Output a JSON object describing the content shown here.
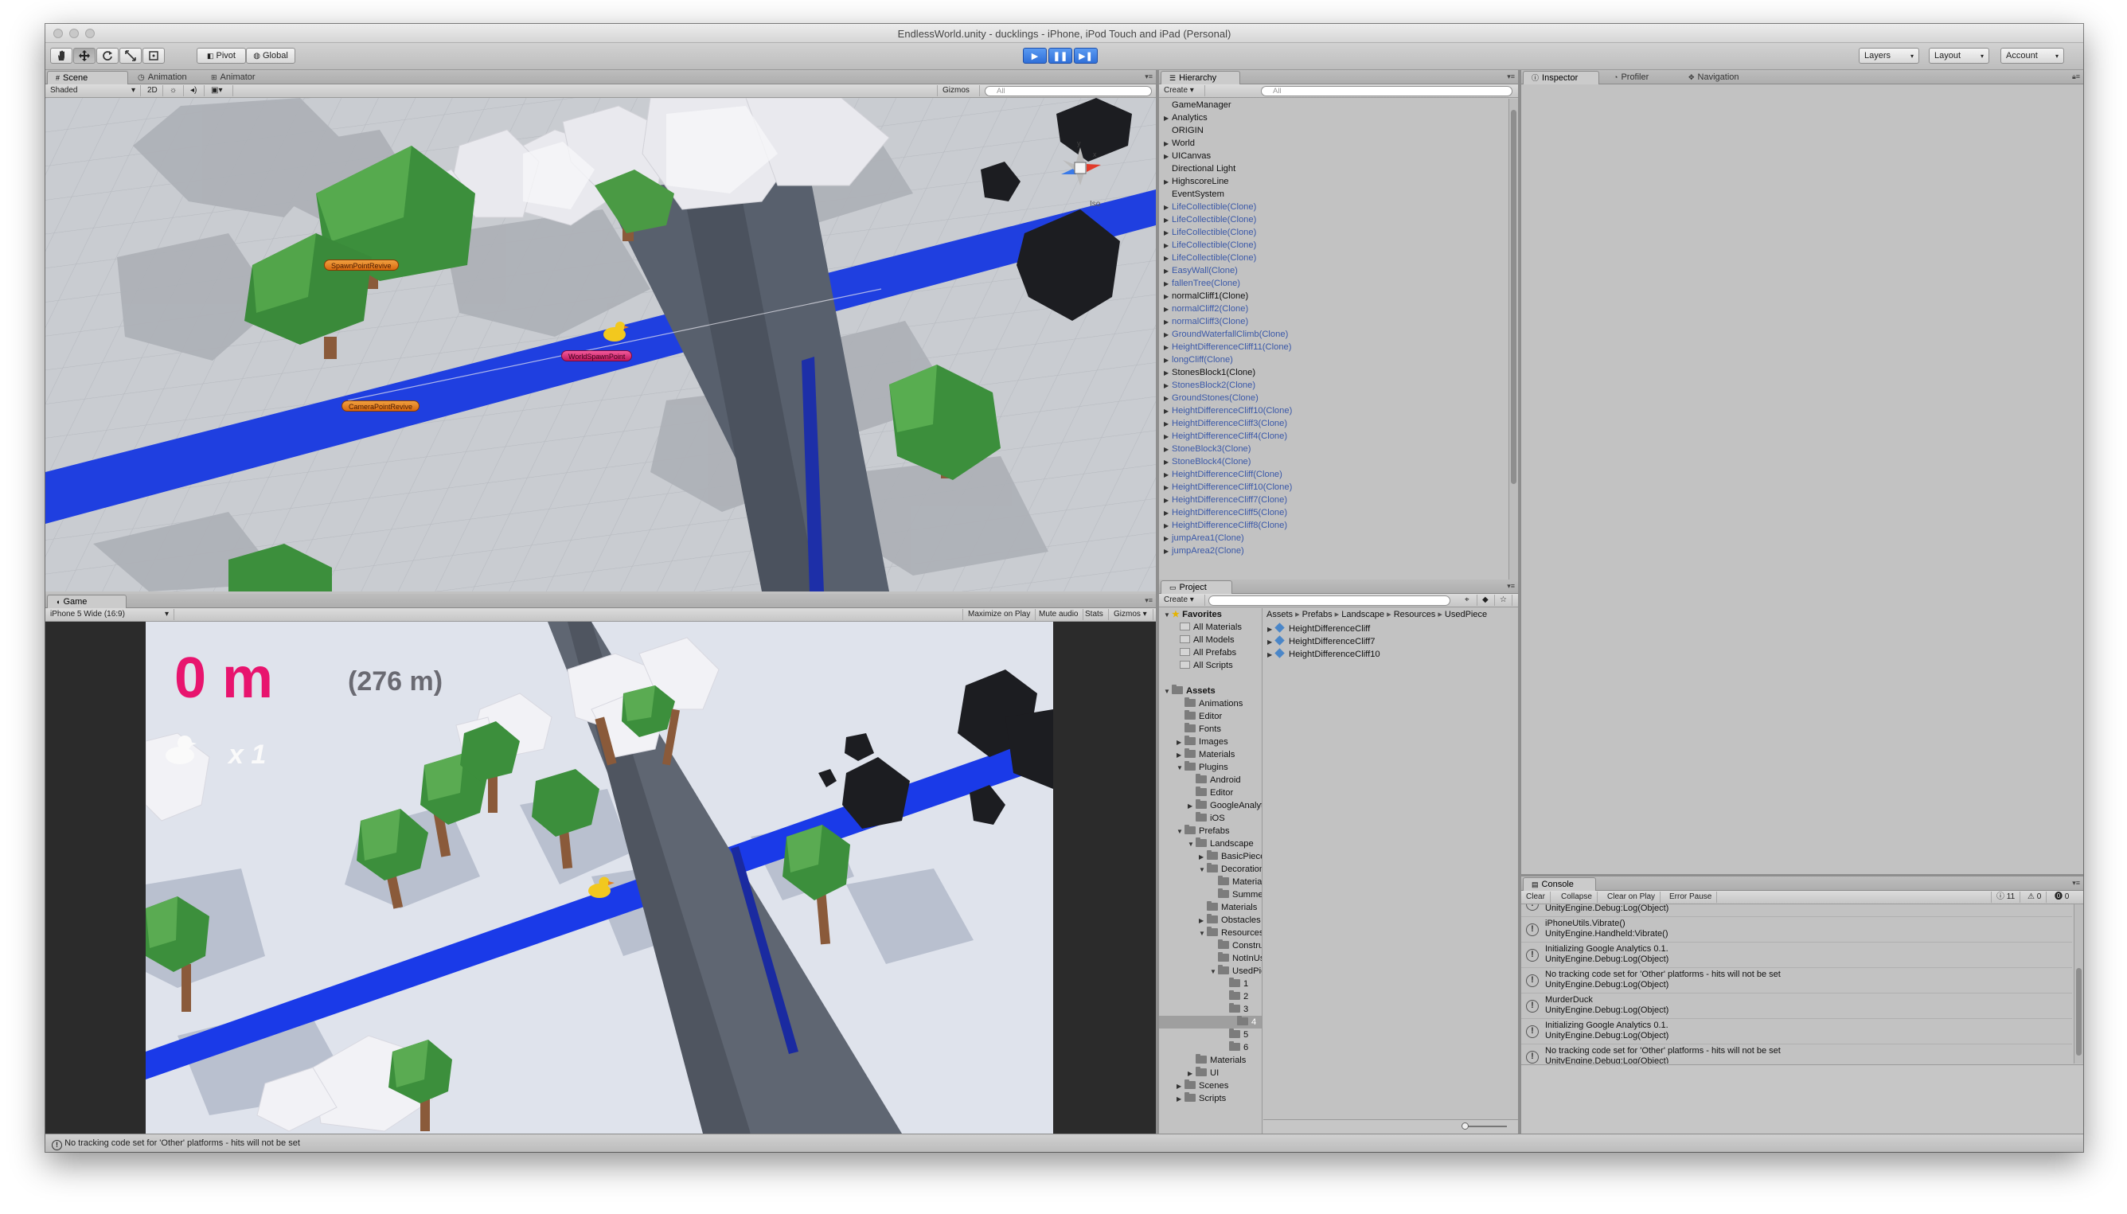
{
  "window": {
    "title": "EndlessWorld.unity - ducklings - iPhone, iPod Touch and iPad (Personal)"
  },
  "toolbar": {
    "pivot_label": "Pivot",
    "global_label": "Global",
    "layers_label": "Layers",
    "layout_label": "Layout",
    "account_label": "Account"
  },
  "scene_panel": {
    "tabs": [
      "Scene",
      "Animation",
      "Animator"
    ],
    "shading_mode": "Shaded",
    "mode_2d": "2D",
    "gizmos_label": "Gizmos",
    "search_placeholder": "All",
    "tags": [
      "SpawnPointRevive",
      "WorldSpawnPoint",
      "CameraPointRevive"
    ],
    "gizmo_persp_label": "Iso"
  },
  "game_panel": {
    "tab": "Game",
    "aspect": "iPhone 5 Wide (16:9)",
    "options": [
      "Maximize on Play",
      "Mute audio",
      "Stats",
      "Gizmos"
    ],
    "distance": "0 m",
    "best": "(276 m)",
    "lives": "x 1"
  },
  "hierarchy": {
    "tab": "Hierarchy",
    "create_label": "Create",
    "search_placeholder": "All",
    "items": [
      {
        "label": "GameManager",
        "arrow": false,
        "clone": false
      },
      {
        "label": "Analytics",
        "arrow": true,
        "clone": false
      },
      {
        "label": "ORIGIN",
        "arrow": false,
        "clone": false
      },
      {
        "label": "World",
        "arrow": true,
        "clone": false
      },
      {
        "label": "UICanvas",
        "arrow": true,
        "clone": false
      },
      {
        "label": "Directional Light",
        "arrow": false,
        "clone": false
      },
      {
        "label": "HighscoreLine",
        "arrow": true,
        "clone": false
      },
      {
        "label": "EventSystem",
        "arrow": false,
        "clone": false
      },
      {
        "label": "LifeCollectible(Clone)",
        "arrow": true,
        "clone": true
      },
      {
        "label": "LifeCollectible(Clone)",
        "arrow": true,
        "clone": true
      },
      {
        "label": "LifeCollectible(Clone)",
        "arrow": true,
        "clone": true
      },
      {
        "label": "LifeCollectible(Clone)",
        "arrow": true,
        "clone": true
      },
      {
        "label": "LifeCollectible(Clone)",
        "arrow": true,
        "clone": true
      },
      {
        "label": "EasyWall(Clone)",
        "arrow": true,
        "clone": true
      },
      {
        "label": "fallenTree(Clone)",
        "arrow": true,
        "clone": true
      },
      {
        "label": "normalCliff1(Clone)",
        "arrow": true,
        "clone": false
      },
      {
        "label": "normalCliff2(Clone)",
        "arrow": true,
        "clone": true
      },
      {
        "label": "normalCliff3(Clone)",
        "arrow": true,
        "clone": true
      },
      {
        "label": "GroundWaterfallClimb(Clone)",
        "arrow": true,
        "clone": true
      },
      {
        "label": "HeightDifferenceCliff11(Clone)",
        "arrow": true,
        "clone": true
      },
      {
        "label": "longCliff(Clone)",
        "arrow": true,
        "clone": true
      },
      {
        "label": "StonesBlock1(Clone)",
        "arrow": true,
        "clone": false
      },
      {
        "label": "StonesBlock2(Clone)",
        "arrow": true,
        "clone": true
      },
      {
        "label": "GroundStones(Clone)",
        "arrow": true,
        "clone": true
      },
      {
        "label": "HeightDifferenceCliff10(Clone)",
        "arrow": true,
        "clone": true
      },
      {
        "label": "HeightDifferenceCliff3(Clone)",
        "arrow": true,
        "clone": true
      },
      {
        "label": "HeightDifferenceCliff4(Clone)",
        "arrow": true,
        "clone": true
      },
      {
        "label": "StoneBlock3(Clone)",
        "arrow": true,
        "clone": true
      },
      {
        "label": "StoneBlock4(Clone)",
        "arrow": true,
        "clone": true
      },
      {
        "label": "HeightDifferenceCliff(Clone)",
        "arrow": true,
        "clone": true
      },
      {
        "label": "HeightDifferenceCliff10(Clone)",
        "arrow": true,
        "clone": true
      },
      {
        "label": "HeightDifferenceCliff7(Clone)",
        "arrow": true,
        "clone": true
      },
      {
        "label": "HeightDifferenceCliff5(Clone)",
        "arrow": true,
        "clone": true
      },
      {
        "label": "HeightDifferenceCliff8(Clone)",
        "arrow": true,
        "clone": true
      },
      {
        "label": "jumpArea1(Clone)",
        "arrow": true,
        "clone": true
      },
      {
        "label": "jumpArea2(Clone)",
        "arrow": true,
        "clone": true
      }
    ]
  },
  "project": {
    "tab": "Project",
    "create_label": "Create",
    "favorites_label": "Favorites",
    "favorites": [
      "All Materials",
      "All Models",
      "All Prefabs",
      "All Scripts"
    ],
    "assets_label": "Assets",
    "tree": [
      {
        "label": "Animations",
        "depth": 1,
        "arrow": ""
      },
      {
        "label": "Editor",
        "depth": 1,
        "arrow": ""
      },
      {
        "label": "Fonts",
        "depth": 1,
        "arrow": ""
      },
      {
        "label": "Images",
        "depth": 1,
        "arrow": "▶"
      },
      {
        "label": "Materials",
        "depth": 1,
        "arrow": "▶"
      },
      {
        "label": "Plugins",
        "depth": 1,
        "arrow": "▼"
      },
      {
        "label": "Android",
        "depth": 2,
        "arrow": ""
      },
      {
        "label": "Editor",
        "depth": 2,
        "arrow": ""
      },
      {
        "label": "GoogleAnalyt",
        "depth": 2,
        "arrow": "▶"
      },
      {
        "label": "iOS",
        "depth": 2,
        "arrow": ""
      },
      {
        "label": "Prefabs",
        "depth": 1,
        "arrow": "▼"
      },
      {
        "label": "Landscape",
        "depth": 2,
        "arrow": "▼"
      },
      {
        "label": "BasicPieces",
        "depth": 3,
        "arrow": "▶"
      },
      {
        "label": "Decoration",
        "depth": 3,
        "arrow": "▼"
      },
      {
        "label": "Material",
        "depth": 4,
        "arrow": ""
      },
      {
        "label": "Summer",
        "depth": 4,
        "arrow": ""
      },
      {
        "label": "Materials",
        "depth": 3,
        "arrow": ""
      },
      {
        "label": "Obstacles",
        "depth": 3,
        "arrow": "▶"
      },
      {
        "label": "Resources",
        "depth": 3,
        "arrow": "▼"
      },
      {
        "label": "Constru",
        "depth": 4,
        "arrow": ""
      },
      {
        "label": "NotInUs",
        "depth": 4,
        "arrow": ""
      },
      {
        "label": "UsedPie",
        "depth": 4,
        "arrow": "▼"
      },
      {
        "label": "1",
        "depth": 5,
        "arrow": ""
      },
      {
        "label": "2",
        "depth": 5,
        "arrow": ""
      },
      {
        "label": "3",
        "depth": 5,
        "arrow": ""
      },
      {
        "label": "4",
        "depth": 5,
        "arrow": "",
        "selected": true
      },
      {
        "label": "5",
        "depth": 5,
        "arrow": ""
      },
      {
        "label": "6",
        "depth": 5,
        "arrow": ""
      },
      {
        "label": "Materials",
        "depth": 2,
        "arrow": ""
      },
      {
        "label": "UI",
        "depth": 2,
        "arrow": "▶"
      },
      {
        "label": "Scenes",
        "depth": 1,
        "arrow": "▶"
      },
      {
        "label": "Scripts",
        "depth": 1,
        "arrow": "▶"
      }
    ],
    "breadcrumb": [
      "Assets",
      "Prefabs",
      "Landscape",
      "Resources",
      "UsedPiece"
    ],
    "files": [
      "HeightDifferenceCliff",
      "HeightDifferenceCliff7",
      "HeightDifferenceCliff10"
    ]
  },
  "inspector": {
    "tabs": [
      "Inspector",
      "Profiler",
      "Navigation"
    ]
  },
  "console": {
    "tab": "Console",
    "buttons": [
      "Clear",
      "Collapse",
      "Clear on Play",
      "Error Pause"
    ],
    "counts": {
      "info": "11",
      "warn": "0",
      "error": "0"
    },
    "entries": [
      {
        "l1": "UnityEngine.Debug:Log(Object)",
        "l2": ""
      },
      {
        "l1": "iPhoneUtils.Vibrate()",
        "l2": "UnityEngine.Handheld:Vibrate()"
      },
      {
        "l1": "Initializing Google Analytics 0.1.",
        "l2": "UnityEngine.Debug:Log(Object)"
      },
      {
        "l1": "No tracking code set for 'Other' platforms - hits will not be set",
        "l2": "UnityEngine.Debug:Log(Object)"
      },
      {
        "l1": "MurderDuck",
        "l2": "UnityEngine.Debug:Log(Object)"
      },
      {
        "l1": "Initializing Google Analytics 0.1.",
        "l2": "UnityEngine.Debug:Log(Object)"
      },
      {
        "l1": "No tracking code set for 'Other' platforms - hits will not be set",
        "l2": "UnityEngine.Debug:Log(Object)"
      }
    ]
  },
  "statusbar": {
    "text": "No tracking code set for 'Other' platforms - hits will not be set"
  },
  "colors": {
    "river": "#1f3fe0",
    "tree_green": "#3f9a3f",
    "distance_pink": "#e8146e",
    "play_blue": "#3a7ae8"
  }
}
